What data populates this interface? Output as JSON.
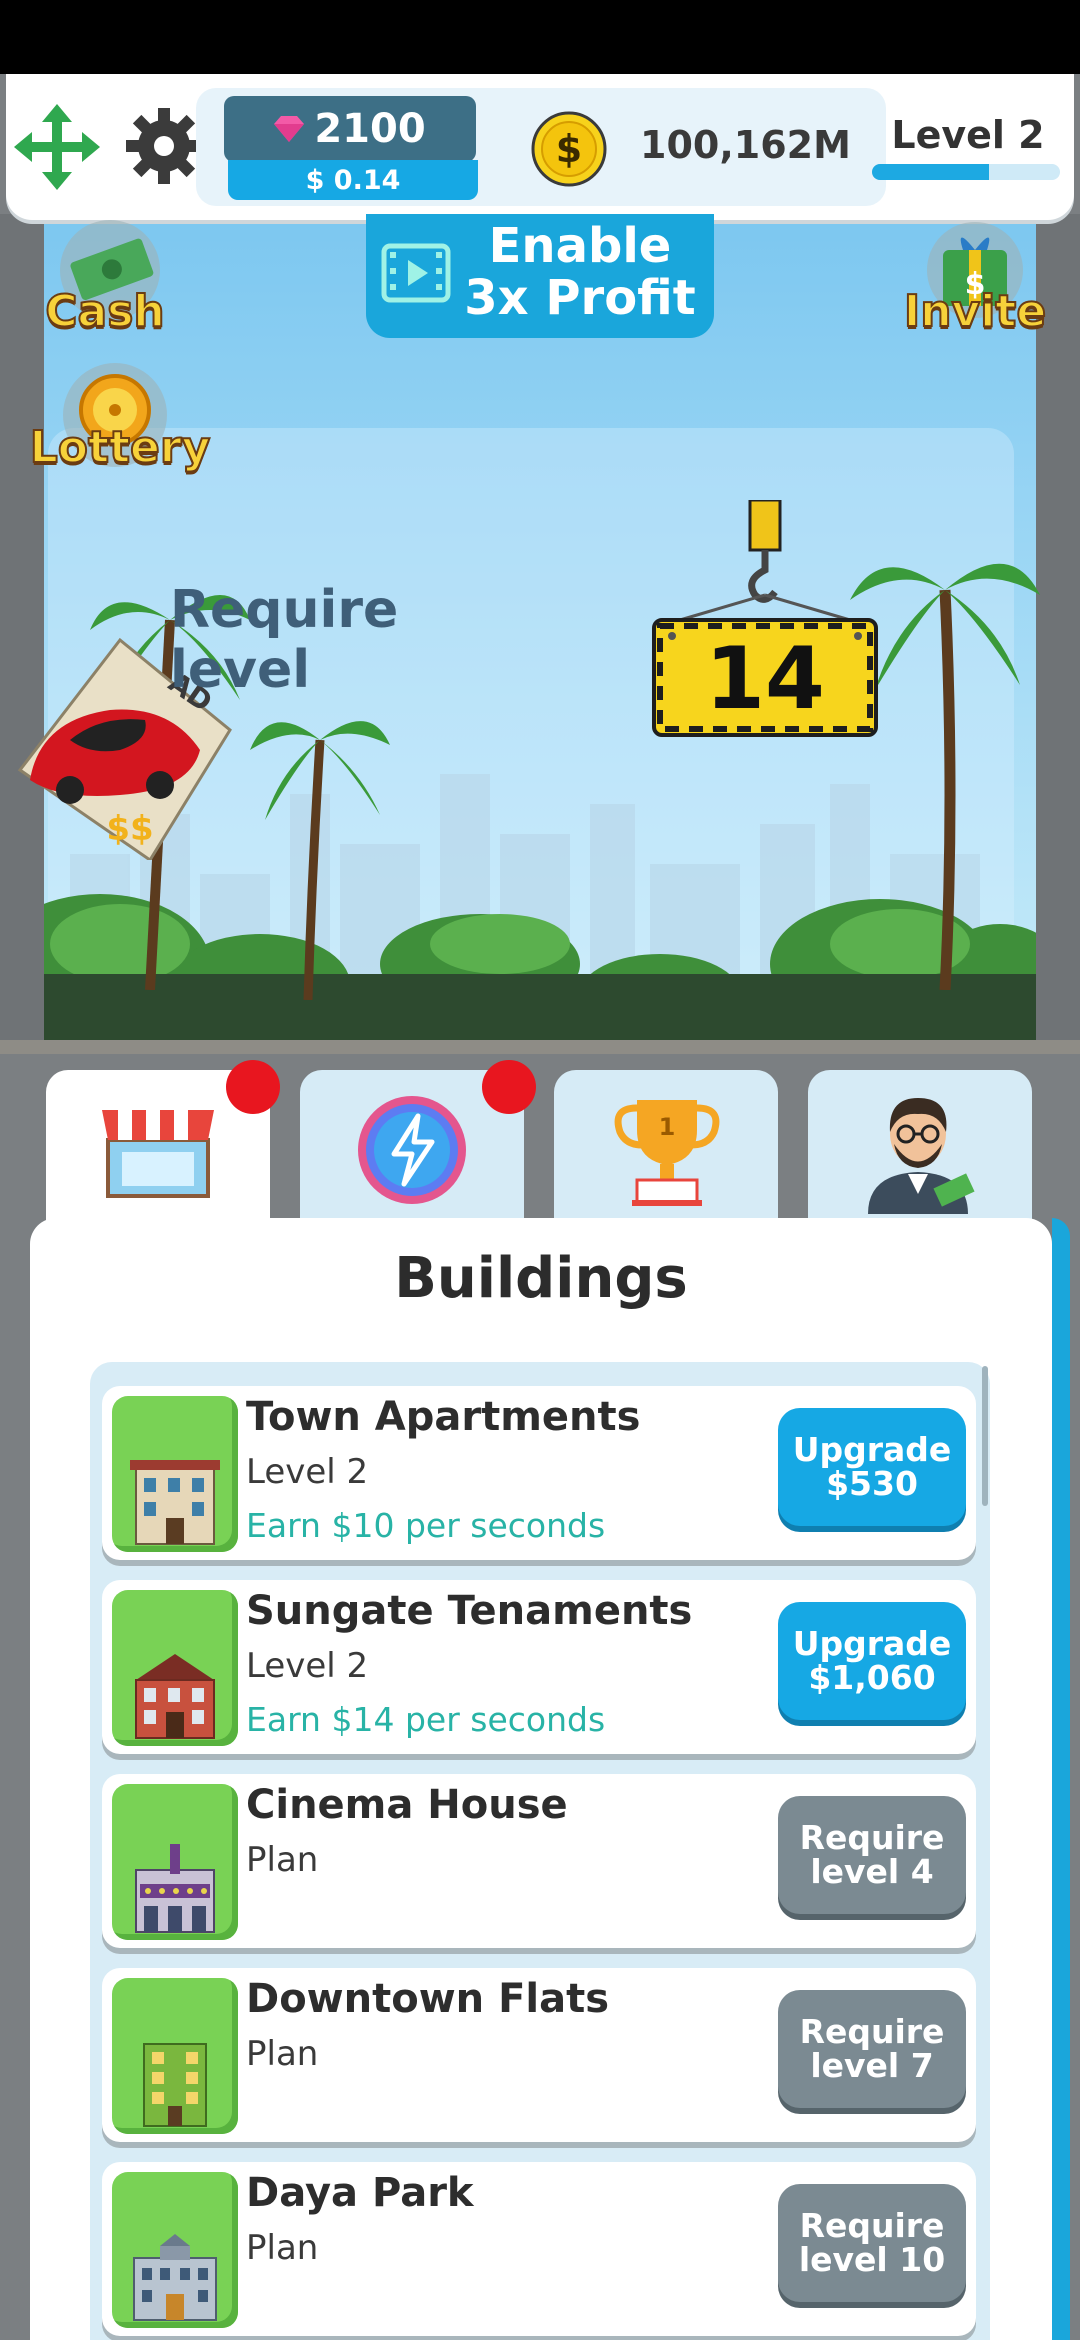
{
  "header": {
    "gems": "2100",
    "usd": "$ 0.14",
    "coins": "100,162M",
    "level_label": "Level 2",
    "level_progress": 0.62
  },
  "scene": {
    "enable_line1": "Enable",
    "enable_line2": "3x Profit",
    "cash_label": "Cash",
    "lottery_label": "Lottery",
    "invite_label": "Invite",
    "require_text": "Require level",
    "required_level": "14",
    "ad_badge": "AD"
  },
  "tabs": [
    {
      "name": "shop",
      "notification": true
    },
    {
      "name": "boost",
      "notification": true
    },
    {
      "name": "trophy",
      "notification": false
    },
    {
      "name": "manager",
      "notification": false
    }
  ],
  "panel": {
    "title": "Buildings",
    "items": [
      {
        "title": "Town Apartments",
        "status": "Level 2",
        "earn": "Earn $10 per seconds",
        "btn1": "Upgrade",
        "btn2": "$530",
        "btn_type": "upgrade"
      },
      {
        "title": "Sungate Tenaments",
        "status": "Level 2",
        "earn": "Earn $14 per seconds",
        "btn1": "Upgrade",
        "btn2": "$1,060",
        "btn_type": "upgrade"
      },
      {
        "title": "Cinema House",
        "status": "Plan",
        "earn": "",
        "btn1": "Require",
        "btn2": "level 4",
        "btn_type": "require"
      },
      {
        "title": "Downtown Flats",
        "status": "Plan",
        "earn": "",
        "btn1": "Require",
        "btn2": "level 7",
        "btn_type": "require"
      },
      {
        "title": "Daya Park",
        "status": "Plan",
        "earn": "",
        "btn1": "Require",
        "btn2": "level 10",
        "btn_type": "require"
      }
    ]
  },
  "colors": {
    "accent": "#16a8e4",
    "gem": "#3d6f86",
    "grass": "#79d255",
    "require_btn": "#7b8a92",
    "notification": "#e8161f"
  }
}
